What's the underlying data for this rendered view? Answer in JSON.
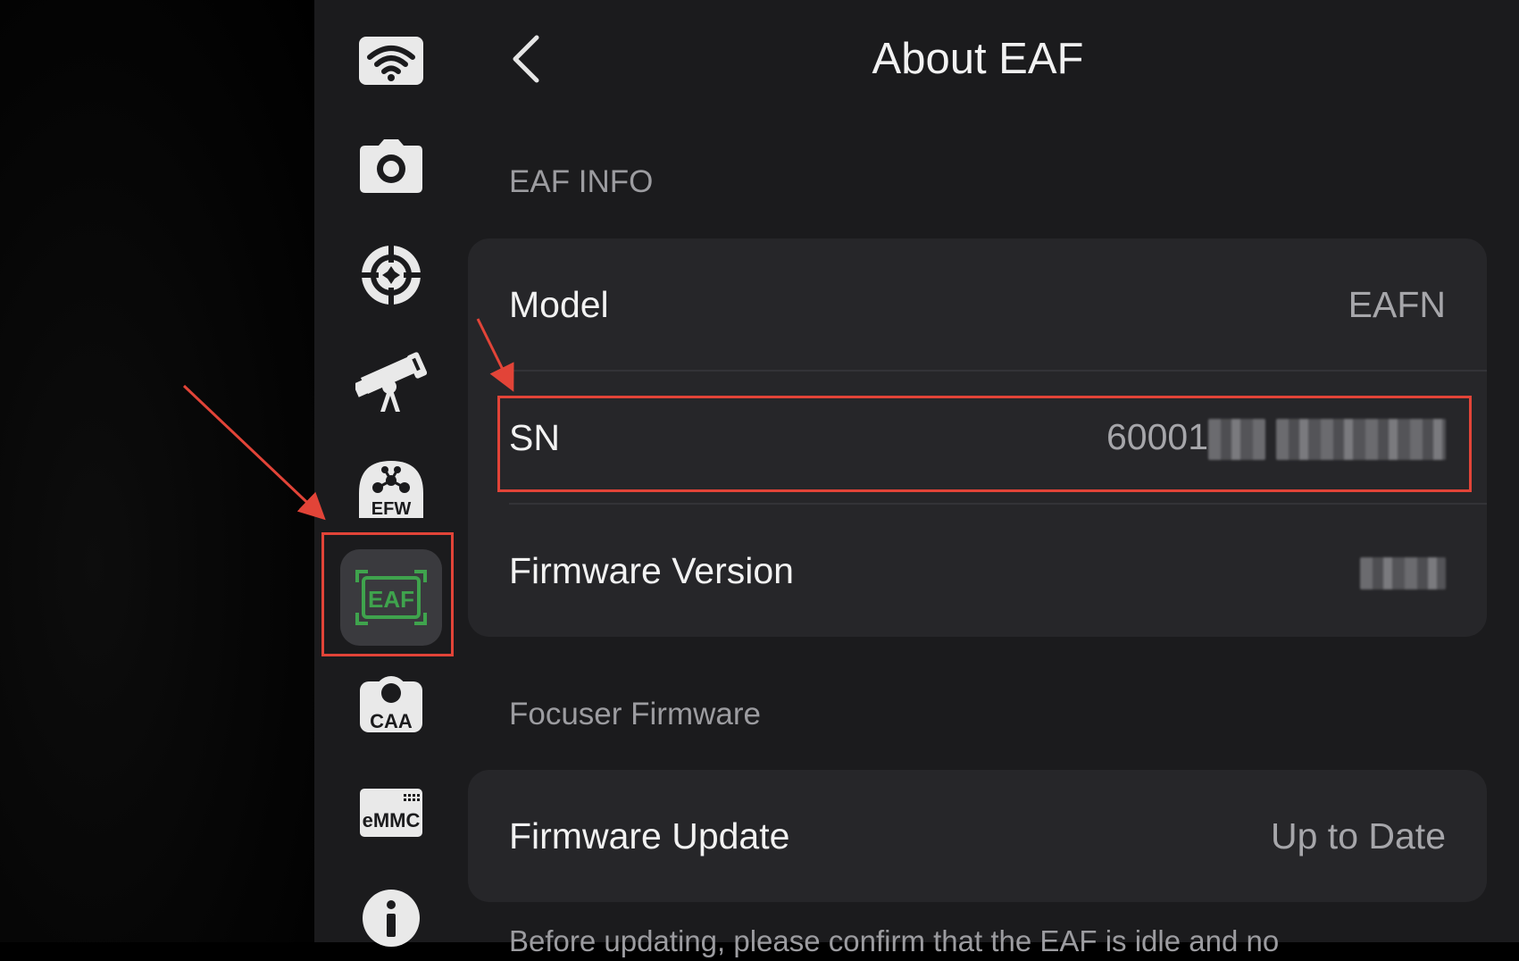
{
  "header": {
    "title": "About EAF"
  },
  "sections": {
    "info_label": "EAF INFO",
    "firmware_label": "Focuser Firmware"
  },
  "info": {
    "model_label": "Model",
    "model_value": "EAFN",
    "sn_label": "SN",
    "sn_value_visible": "60001",
    "firmware_version_label": "Firmware Version"
  },
  "firmware": {
    "update_label": "Firmware Update",
    "update_value": "Up to Date",
    "note": "Before updating, please confirm that the EAF is idle and no"
  },
  "sidebar": {
    "items": [
      {
        "name": "wifi-icon"
      },
      {
        "name": "camera-icon"
      },
      {
        "name": "crosshair-icon"
      },
      {
        "name": "telescope-icon"
      },
      {
        "name": "efw-icon",
        "label": "EFW"
      },
      {
        "name": "eaf-icon",
        "label": "EAF",
        "active": true
      },
      {
        "name": "caa-icon",
        "label": "CAA"
      },
      {
        "name": "emmc-icon",
        "label": "eMMC"
      },
      {
        "name": "info-icon"
      }
    ]
  },
  "colors": {
    "accent_green": "#3fa34d",
    "highlight_red": "#e24438"
  }
}
